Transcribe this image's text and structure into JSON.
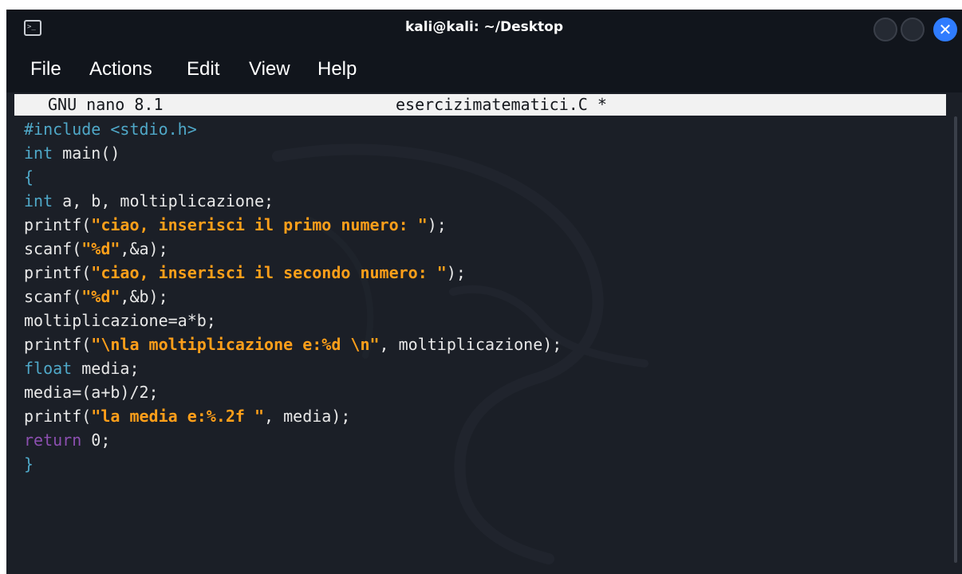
{
  "window": {
    "title": "kali@kali: ~/Desktop",
    "close_glyph": "✕",
    "terminal_icon_glyph": ">_"
  },
  "menu": {
    "items": [
      "File",
      "Actions",
      "Edit",
      "View",
      "Help"
    ]
  },
  "nano": {
    "version": "GNU nano 8.1",
    "filename": "esercizimatematici.C *"
  },
  "code": {
    "l1": "#include <stdio.h>",
    "l2_kw": "int",
    "l2_rest": " main()",
    "l3": "{",
    "l4_kw": "int",
    "l4_rest": " a, b, moltiplicazione;",
    "l5_a": "printf(",
    "l5_str": "\"ciao, inserisci il primo numero: \"",
    "l5_b": ");",
    "l6_a": "scanf(",
    "l6_str": "\"%d\"",
    "l6_b": ",&a);",
    "l7_a": "printf(",
    "l7_str": "\"ciao, inserisci il secondo numero: \"",
    "l7_b": ");",
    "l8_a": "scanf(",
    "l8_str": "\"%d\"",
    "l8_b": ",&b);",
    "l9": "moltiplicazione=a*b;",
    "l10_a": "printf(",
    "l10_str": "\"\\nla moltiplicazione e:%d \\n\"",
    "l10_b": ", moltiplicazione);",
    "l11_kw": "float",
    "l11_rest": " media;",
    "l12": "media=(a+b)/2;",
    "l13_a": "printf(",
    "l13_str": "\"la media e:%.2f \"",
    "l13_b": ", media);",
    "l14_kw": "return",
    "l14_rest": " 0;",
    "l15": "}"
  },
  "colors": {
    "background": "#1b1f27",
    "keyword": "#4fa8c8",
    "string": "#ff9f1a",
    "return_keyword": "#8c4fb0",
    "close_button": "#2f7cff"
  },
  "icons": [
    "terminal-icon",
    "minimize-icon",
    "maximize-icon",
    "close-icon",
    "kali-dragon-watermark"
  ]
}
